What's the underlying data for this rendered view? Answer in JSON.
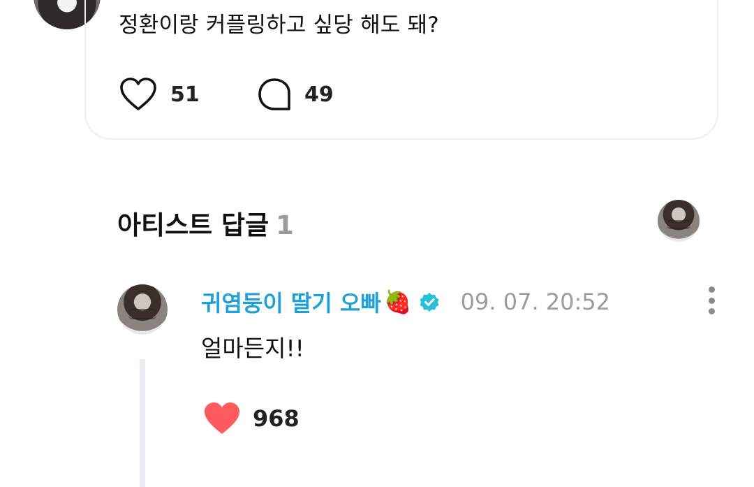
{
  "post": {
    "text": "정환이랑 커플링하고 싶당 해도 돼?",
    "like_count": "51",
    "comment_count": "49"
  },
  "section": {
    "title": "아티스트 답글",
    "count": "1"
  },
  "reply": {
    "author": "귀염둥이 딸기 오빠",
    "author_emoji": "🍓",
    "timestamp": "09. 07. 20:52",
    "text": "얼마든지!!",
    "like_count": "968"
  },
  "icons": {
    "like": "heart-outline-icon",
    "comment": "speech-bubble-icon",
    "verified": "verified-badge-icon",
    "more": "more-vertical-icon",
    "liked": "heart-filled-icon"
  },
  "colors": {
    "author": "#1fa0d6",
    "verified": "#2bc0d8",
    "liked_heart": "#ff5a5f",
    "muted": "#9c9c9c"
  }
}
